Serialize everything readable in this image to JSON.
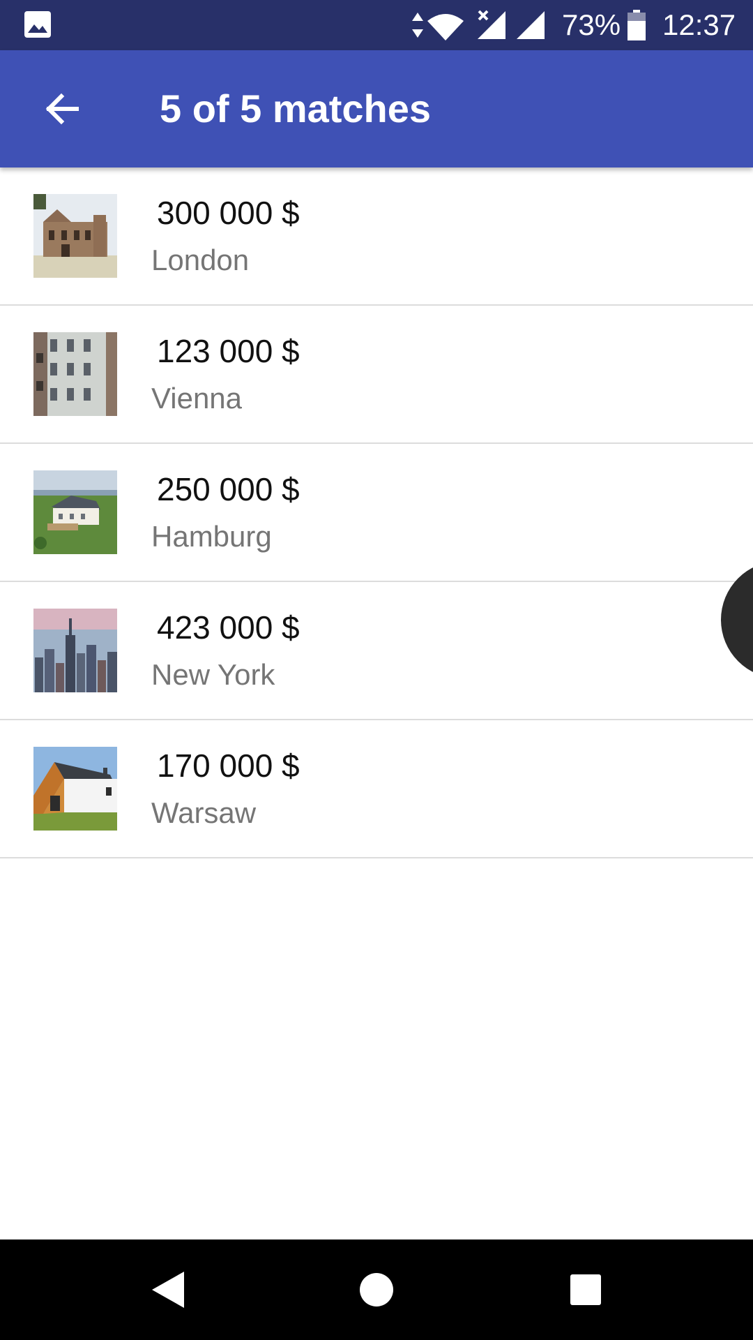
{
  "status_bar": {
    "battery_percent": "73%",
    "time": "12:37",
    "icons": [
      "gallery-icon",
      "data-arrows-icon",
      "wifi-icon",
      "signal-no-service-icon",
      "signal-icon",
      "battery-icon"
    ]
  },
  "app_bar": {
    "title": "5 of 5 matches",
    "back_icon": "arrow-back-icon"
  },
  "listings": [
    {
      "price": "300 000 $",
      "city": "London",
      "thumbnail": "mansion-photo"
    },
    {
      "price": "123 000 $",
      "city": "Vienna",
      "thumbnail": "building-facade-photo"
    },
    {
      "price": "250 000 $",
      "city": "Hamburg",
      "thumbnail": "villa-aerial-photo"
    },
    {
      "price": "423 000 $",
      "city": "New York",
      "thumbnail": "city-skyline-photo"
    },
    {
      "price": "170 000 $",
      "city": "Warsaw",
      "thumbnail": "modern-house-photo"
    }
  ],
  "nav_bar": {
    "buttons": [
      "nav-back-icon",
      "nav-home-icon",
      "nav-recents-icon"
    ]
  },
  "colors": {
    "status_bar": "#283069",
    "app_bar": "#3f51b5",
    "price_text": "#111111",
    "city_text": "#757575",
    "divider": "#dcdcdc"
  }
}
